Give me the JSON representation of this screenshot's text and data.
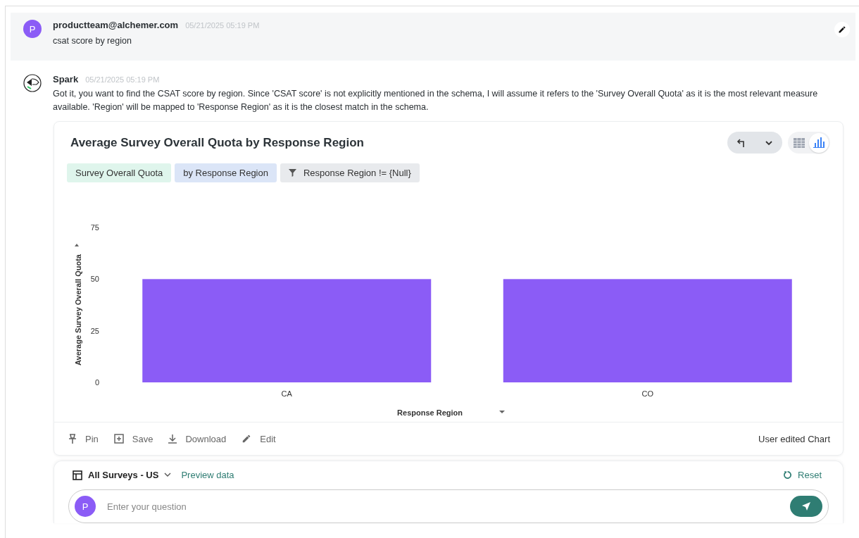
{
  "user_message": {
    "avatar": "P",
    "author": "productteam@alchemer.com",
    "time": "05/21/2025 05:19 PM",
    "text": "csat score by region"
  },
  "reply": {
    "author": "Spark",
    "time": "05/21/2025 05:19 PM",
    "text": "Got it, you want to find the CSAT score by region. Since 'CSAT score' is not explicitly mentioned in the schema, I will assume it refers to the 'Survey Overall Quota' as it is the most relevant measure available. 'Region' will be mapped to 'Response Region' as it is the closest match in the schema."
  },
  "chart_card": {
    "title": "Average Survey Overall Quota by Response Region",
    "views": [
      {
        "kind": "table",
        "selected": false
      },
      {
        "kind": "chart",
        "selected": true
      }
    ],
    "chips": [
      {
        "kind": "measure",
        "label": "Survey Overall Quota"
      },
      {
        "kind": "group",
        "label": "by Response Region"
      },
      {
        "kind": "filter",
        "label": "Response Region != {Null}"
      }
    ],
    "chart_data": {
      "type": "bar",
      "xlabel": "Response Region",
      "ylabel": "Average Survey Overall Quota",
      "categories": [
        "CA",
        "CO"
      ],
      "values": [
        50,
        50
      ],
      "ylim": [
        0,
        75
      ],
      "yticks": [
        0,
        25,
        50,
        75
      ]
    },
    "actions": [
      {
        "kind": "pin",
        "label": "Pin"
      },
      {
        "kind": "save",
        "label": "Save"
      },
      {
        "kind": "download",
        "label": "Download"
      },
      {
        "kind": "edit",
        "label": "Edit"
      }
    ],
    "note": "User edited Chart"
  },
  "composer": {
    "dataset": "All Surveys - US",
    "preview": "Preview data",
    "reset": "Reset",
    "avatar": "P",
    "placeholder": "Enter your question"
  }
}
